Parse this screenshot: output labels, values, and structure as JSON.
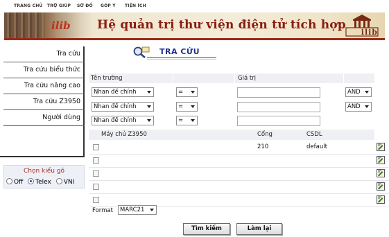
{
  "topnav": [
    "TRANG CHỦ",
    "TRỢ GIÚP",
    "SƠ ĐỒ",
    "GÓP Ý",
    "TIỆN ÍCH"
  ],
  "banner": {
    "brand_small": "ilib",
    "title": "Hệ quản trị thư viện điện tử tích hợp",
    "logo_text": "ilib"
  },
  "sidebar": {
    "items": [
      "Tra cứu",
      "Tra cứu biểu thức",
      "Tra cứu nâng cao",
      "Tra cứu Z3950",
      "Người dùng"
    ]
  },
  "typing": {
    "label": "Chọn kiểu gõ",
    "options": [
      {
        "label": "Off",
        "selected": false
      },
      {
        "label": "Telex",
        "selected": true
      },
      {
        "label": "VNI",
        "selected": false
      }
    ]
  },
  "heading": {
    "title": "TRA CỨU"
  },
  "search": {
    "headers": {
      "field": "Tên trường",
      "value": "Giá trị"
    },
    "rows": [
      {
        "field": "Nhan đề chính",
        "op": "=",
        "value": "",
        "bool": "AND"
      },
      {
        "field": "Nhan đề chính",
        "op": "=",
        "value": "",
        "bool": "AND"
      },
      {
        "field": "Nhan đề chính",
        "op": "=",
        "value": "",
        "bool": ""
      }
    ]
  },
  "servers": {
    "headers": {
      "host": "Máy chủ Z3950",
      "port": "Cổng",
      "db": "CSDL"
    },
    "rows": [
      {
        "host": "",
        "port": "210",
        "db": "default"
      },
      {
        "host": "",
        "port": "",
        "db": ""
      },
      {
        "host": "",
        "port": "",
        "db": ""
      },
      {
        "host": "",
        "port": "",
        "db": ""
      },
      {
        "host": "",
        "port": "",
        "db": ""
      }
    ]
  },
  "format": {
    "label": "Format",
    "value": "MARC21"
  },
  "buttons": {
    "search": "Tìm kiếm",
    "reset": "Làm lại"
  }
}
